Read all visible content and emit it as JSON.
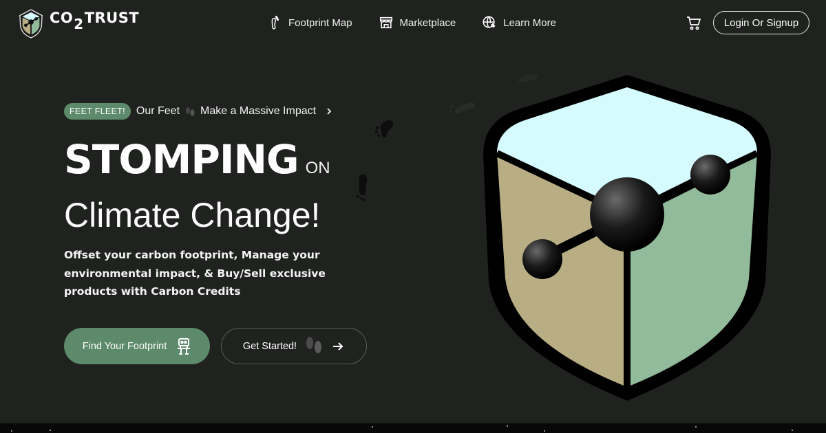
{
  "brand": {
    "name_prefix": "CO",
    "name_sub": "2",
    "name_suffix": "TRUST"
  },
  "nav": {
    "links": [
      {
        "label": "Footprint Map",
        "icon": "footprint-icon"
      },
      {
        "label": "Marketplace",
        "icon": "store-icon"
      },
      {
        "label": "Learn More",
        "icon": "globe-icon"
      }
    ],
    "cart_icon": "cart-icon",
    "login_label": "Login Or Signup"
  },
  "hero": {
    "badge": "FEET FLEET!",
    "badge_text_a": "Our Feet",
    "badge_text_b": "Make a Massive Impact",
    "headline_big": "STOMPING",
    "headline_small": "ON",
    "headline_line2": "Climate Change!",
    "subtitle": "Offset your carbon footprint, Manage your environmental impact, & Buy/Sell exclusive products with Carbon Credits",
    "primary_button": "Find Your Footprint",
    "secondary_button": "Get Started!"
  },
  "colors": {
    "background": "#1f221f",
    "accent": "#5d8a6a",
    "shield_sky": "#d5fbff",
    "shield_tan": "#b9ad84",
    "shield_green": "#92bb9b"
  }
}
